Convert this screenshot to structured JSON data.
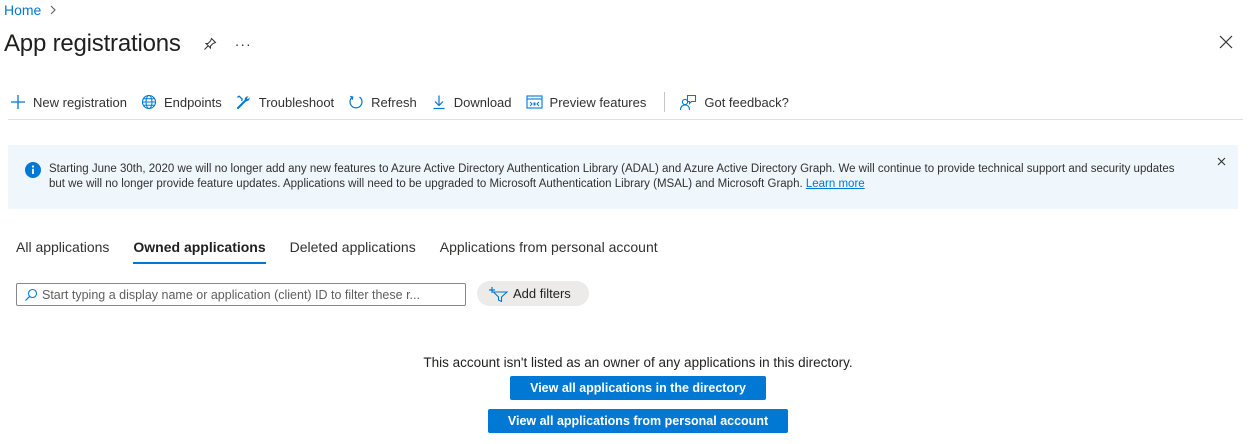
{
  "breadcrumb": {
    "home": "Home"
  },
  "header": {
    "title": "App registrations",
    "more": "···"
  },
  "toolbar": {
    "items": [
      {
        "label": "New registration",
        "icon": "plus-icon"
      },
      {
        "label": "Endpoints",
        "icon": "globe-icon"
      },
      {
        "label": "Troubleshoot",
        "icon": "wrench-icon"
      },
      {
        "label": "Refresh",
        "icon": "refresh-icon"
      },
      {
        "label": "Download",
        "icon": "download-icon"
      },
      {
        "label": "Preview features",
        "icon": "preview-icon"
      },
      {
        "label": "Got feedback?",
        "icon": "feedback-icon"
      }
    ]
  },
  "banner": {
    "text": "Starting June 30th, 2020 we will no longer add any new features to Azure Active Directory Authentication Library (ADAL) and Azure Active Directory Graph. We will continue to provide technical support and security updates but we will no longer provide feature updates. Applications will need to be upgraded to Microsoft Authentication Library (MSAL) and Microsoft Graph.",
    "link": "Learn more"
  },
  "tabs": [
    {
      "label": "All applications",
      "active": false
    },
    {
      "label": "Owned applications",
      "active": true
    },
    {
      "label": "Deleted applications",
      "active": false
    },
    {
      "label": "Applications from personal account",
      "active": false
    }
  ],
  "search": {
    "placeholder": "Start typing a display name or application (client) ID to filter these r...",
    "value": ""
  },
  "filters": {
    "label": "Add filters"
  },
  "empty": {
    "message": "This account isn't listed as an owner of any applications in this directory.",
    "button_directory": "View all applications in the directory",
    "button_personal": "View all applications from personal account"
  },
  "colors": {
    "accent": "#0078d4",
    "banner_bg": "#eff6fc",
    "text": "#323130"
  }
}
